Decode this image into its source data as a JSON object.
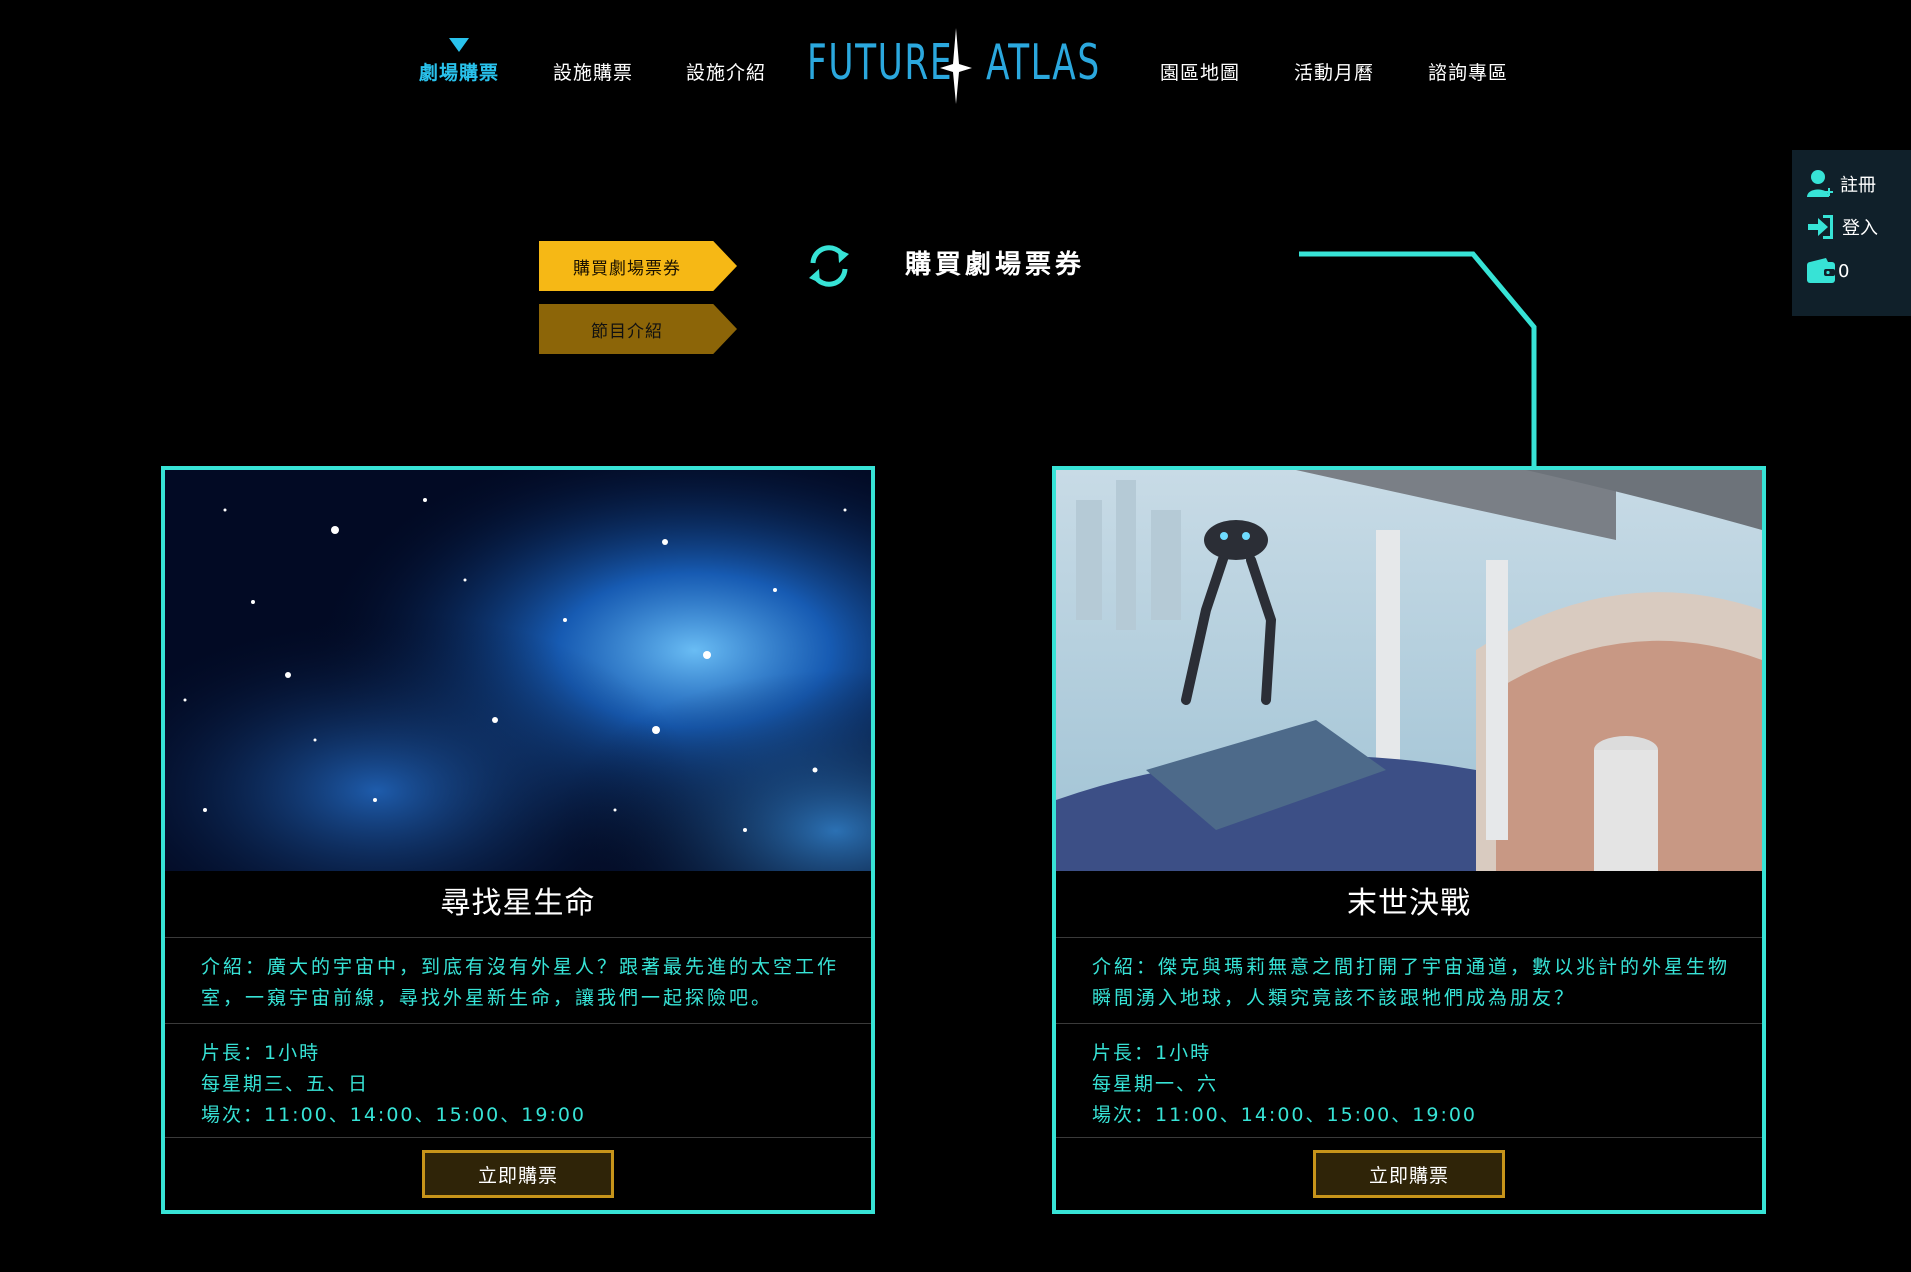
{
  "nav": {
    "left": [
      {
        "label": "劇場購票",
        "active": true
      },
      {
        "label": "設施購票",
        "active": false
      },
      {
        "label": "設施介紹",
        "active": false
      }
    ],
    "right": [
      {
        "label": "園區地圖"
      },
      {
        "label": "活動月曆"
      },
      {
        "label": "諮詢專區"
      }
    ],
    "logo": {
      "left": "FUTURE",
      "right": "ATLAS"
    }
  },
  "side_panel": {
    "register": "註冊",
    "login": "登入",
    "wallet_count": "0"
  },
  "tabs": {
    "buy": "購買劇場票券",
    "info": "節目介紹"
  },
  "section_title": "購買劇場票券",
  "shows": [
    {
      "name": "尋找星生命",
      "description": "介紹：廣大的宇宙中，到底有沒有外星人？跟著最先進的太空工作室，一窺宇宙前線，尋找外星新生命，讓我們一起探險吧。",
      "duration": "片長：1小時",
      "days": "每星期三、五、日",
      "showtimes": "場次：11:00、14:00、15:00、19:00",
      "button": "立即購票",
      "image": "starfield-nebula"
    },
    {
      "name": "末世決戰",
      "description": "介紹：傑克與瑪莉無意之間打開了宇宙通道，數以兆計的外星生物瞬間湧入地球，人類究竟該不該跟牠們成為朋友？",
      "duration": "片長：1小時",
      "days": "每星期一、六",
      "showtimes": "場次：11:00、14:00、15:00、19:00",
      "button": "立即購票",
      "image": "futuristic-arena-robot"
    }
  ],
  "colors": {
    "accent": "#29c2ec",
    "card_border": "#37e3d6",
    "tab_active": "#f6b815",
    "tab_inactive": "#8c6508",
    "button_border": "#c7941a"
  }
}
